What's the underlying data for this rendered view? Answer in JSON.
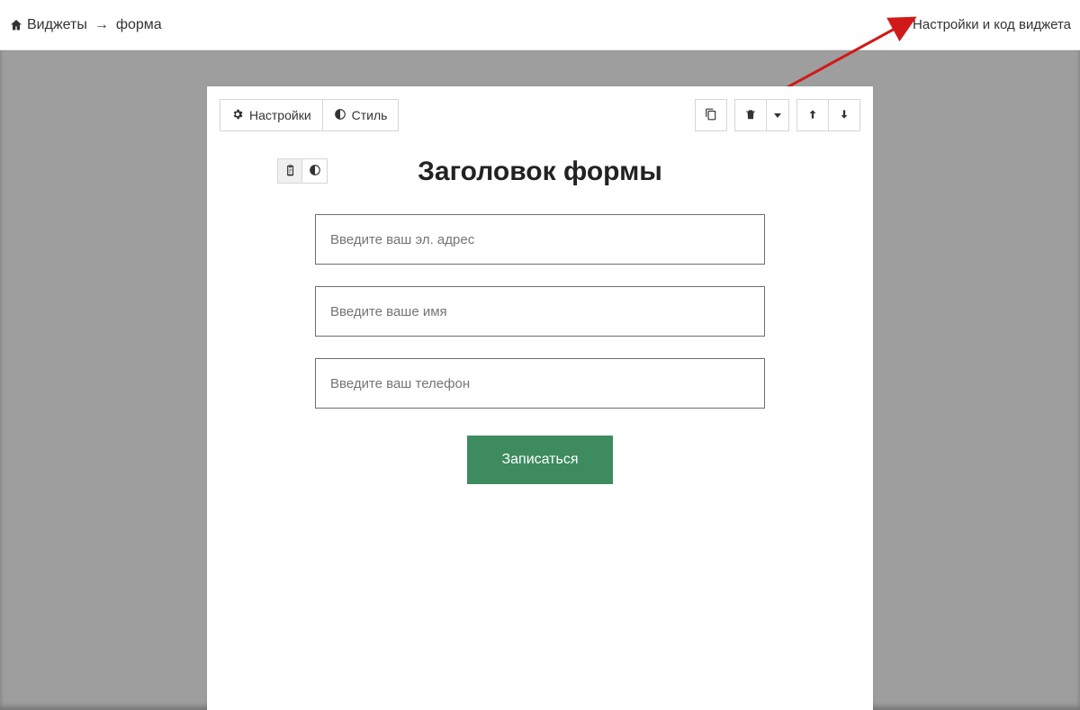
{
  "breadcrumb": {
    "root": "Виджеты",
    "separator": "→",
    "current": "форма"
  },
  "topbar": {
    "settings_link": "Настройки и код виджета"
  },
  "card": {
    "toolbar": {
      "settings_label": "Настройки",
      "style_label": "Стиль"
    },
    "title": "Заголовок формы",
    "fields": {
      "email_placeholder": "Введите ваш эл. адрес",
      "name_placeholder": "Введите ваше имя",
      "phone_placeholder": "Введите ваш телефон"
    },
    "submit_label": "Записаться"
  },
  "colors": {
    "submit_bg": "#3d8b5f",
    "stage_bg": "#9e9e9e",
    "arrow": "#d21919"
  }
}
